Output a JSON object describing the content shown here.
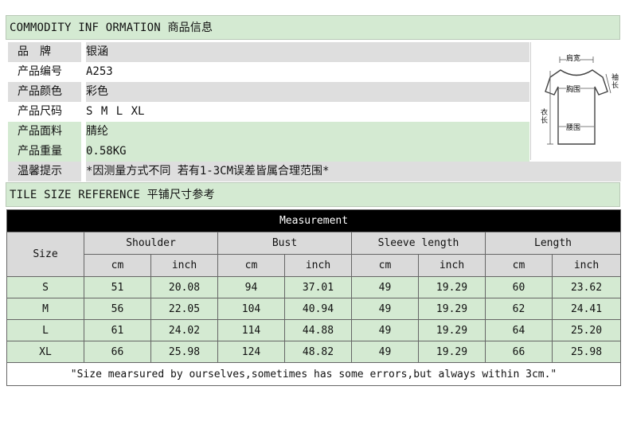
{
  "commodity_header": "COMMODITY INF ORMATION 商品信息",
  "info": [
    {
      "label": "品　牌",
      "value": "银涵"
    },
    {
      "label": "产品编号",
      "value": "A253"
    },
    {
      "label": "产品颜色",
      "value": "彩色"
    },
    {
      "label": "产品尺码",
      "value": "S M L XL"
    },
    {
      "label": "产品面料",
      "value": "腈纶"
    },
    {
      "label": "产品重量",
      "value": "0.58KG"
    },
    {
      "label": "温馨提示",
      "value": "*因测量方式不同 若有1-3CM误差皆属合理范围*"
    }
  ],
  "diagram": {
    "shoulder": "肩宽",
    "sleeve": "袖长",
    "bust": "胸围",
    "length": "衣长",
    "waist": "腰围"
  },
  "tile_header": "TILE SIZE REFERENCE 平铺尺寸参考",
  "table": {
    "title": "Measurement",
    "size_label": "Size",
    "groups": [
      "Shoulder",
      "Bust",
      "Sleeve length",
      "Length"
    ],
    "units": [
      "cm",
      "inch",
      "cm",
      "inch",
      "cm",
      "inch",
      "cm",
      "inch"
    ],
    "rows": [
      [
        "S",
        "51",
        "20.08",
        "94",
        "37.01",
        "49",
        "19.29",
        "60",
        "23.62"
      ],
      [
        "M",
        "56",
        "22.05",
        "104",
        "40.94",
        "49",
        "19.29",
        "62",
        "24.41"
      ],
      [
        "L",
        "61",
        "24.02",
        "114",
        "44.88",
        "49",
        "19.29",
        "64",
        "25.20"
      ],
      [
        "XL",
        "66",
        "25.98",
        "124",
        "48.82",
        "49",
        "19.29",
        "66",
        "25.98"
      ]
    ],
    "note": "\"Size mearsured by ourselves,sometimes has some errors,but always within 3cm.\""
  }
}
